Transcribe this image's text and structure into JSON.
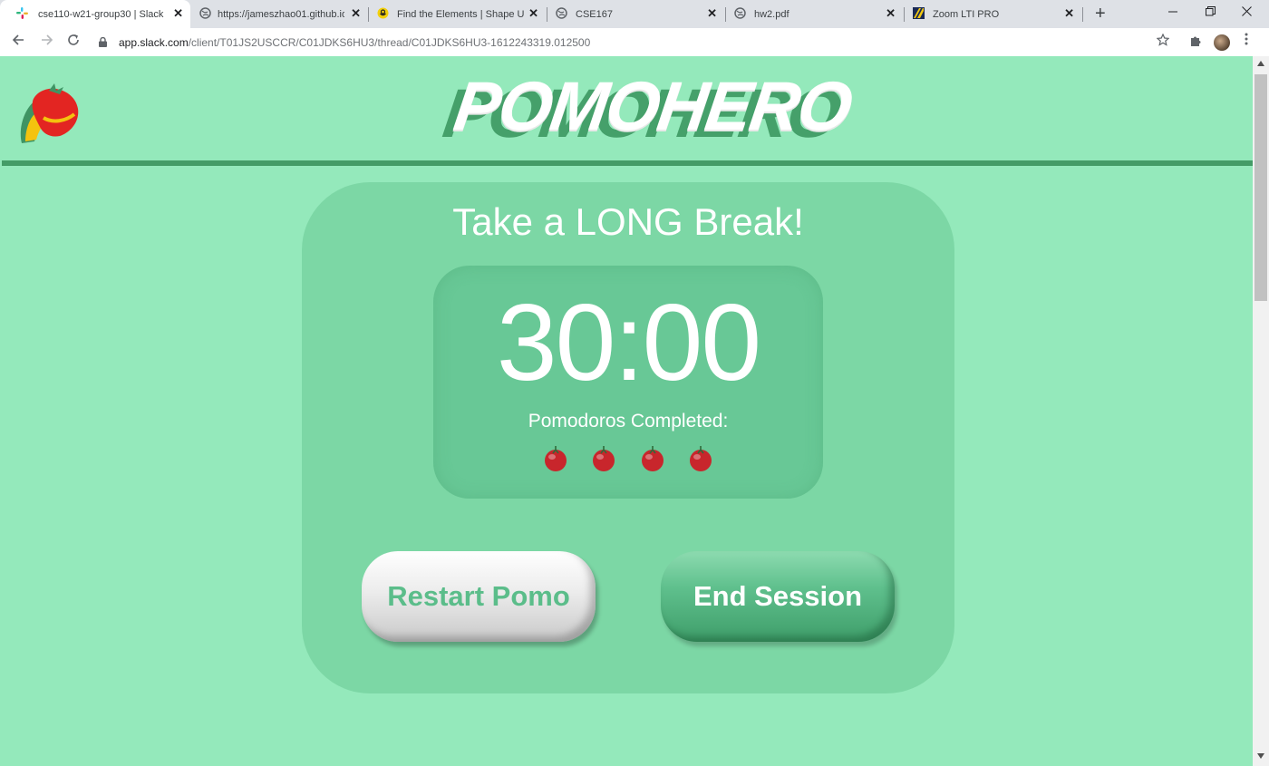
{
  "browser": {
    "tabs": [
      {
        "title": "cse110-w21-group30 | Slack",
        "icon": "slack-icon",
        "active": true
      },
      {
        "title": "https://jameszhao01.github.io",
        "icon": "globe-icon"
      },
      {
        "title": "Find the Elements | Shape Up",
        "icon": "shapeup-icon"
      },
      {
        "title": "CSE167",
        "icon": "globe-icon"
      },
      {
        "title": "hw2.pdf",
        "icon": "globe-icon"
      },
      {
        "title": "Zoom LTI PRO",
        "icon": "zoom-lti-icon"
      }
    ],
    "close_glyph": "✕",
    "new_tab_glyph": "+",
    "url_host": "app.slack.com",
    "url_path": "/client/T01JS2USCCR/C01JDKS6HU3/thread/C01JDKS6HU3-1612243319.012500"
  },
  "app": {
    "brand": "POMOHERO",
    "status_title": "Take a LONG Break!",
    "timer": "30:00",
    "completed_label": "Pomodoros Completed:",
    "pomodoros_completed": 4,
    "restart_label": "Restart Pomo",
    "end_label": "End Session"
  },
  "colors": {
    "background": "#94e9bb",
    "card": "#7cd7a5",
    "timer_box": "#68c896",
    "accent_dark": "#449c67",
    "tomato_red": "#c8262c"
  }
}
